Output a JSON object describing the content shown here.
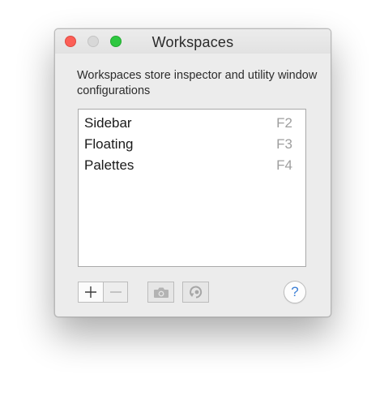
{
  "window": {
    "title": "Workspaces"
  },
  "description": "Workspaces store inspector and utility window configurations",
  "workspaces": [
    {
      "name": "Sidebar",
      "shortcut": "F2"
    },
    {
      "name": "Floating",
      "shortcut": "F3"
    },
    {
      "name": "Palettes",
      "shortcut": "F4"
    }
  ],
  "toolbar": {
    "add_icon": "plus-icon",
    "remove_icon": "minus-icon",
    "capture_icon": "camera-icon",
    "restore_icon": "restore-icon"
  },
  "help": {
    "label": "?"
  },
  "colors": {
    "close": "#fc5f57",
    "maximize": "#2ec840",
    "help_accent": "#3b7fd6"
  }
}
